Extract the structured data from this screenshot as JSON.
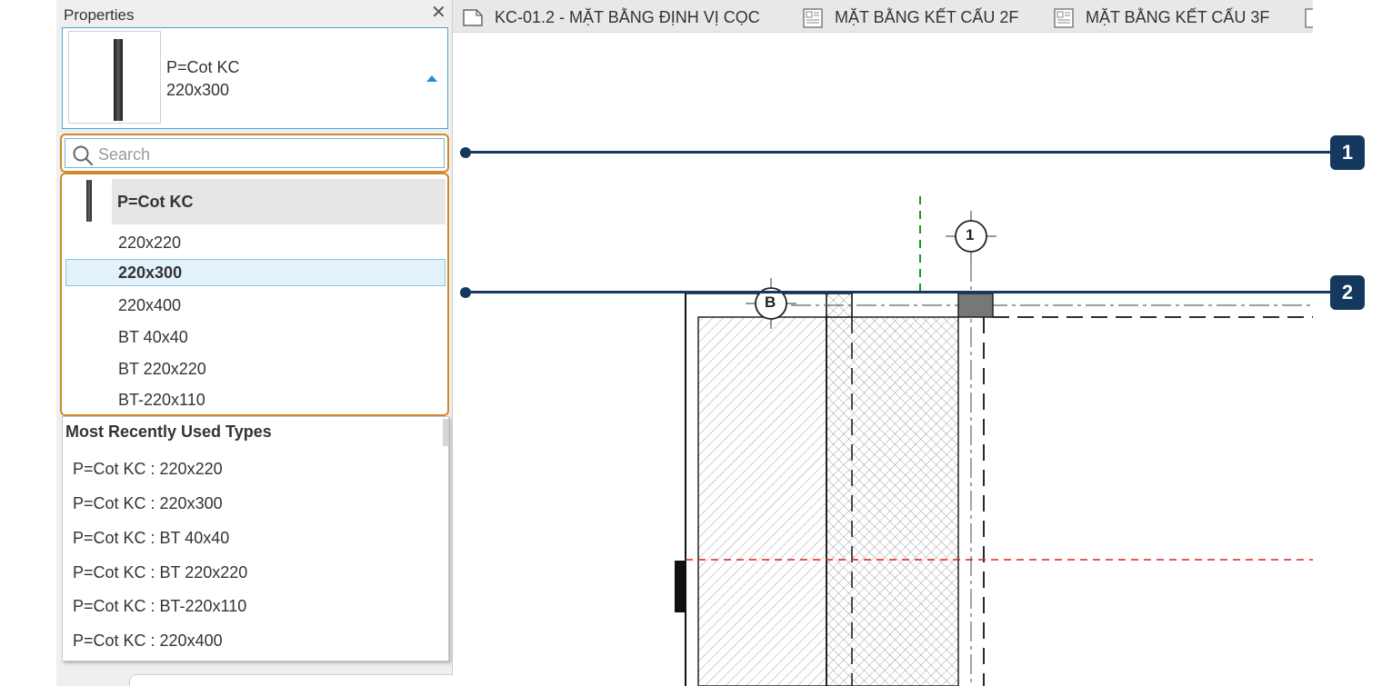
{
  "panel": {
    "title": "Properties",
    "close_glyph": "✕"
  },
  "type_selector": {
    "family": "P=Cot KC",
    "type": "220x300"
  },
  "search": {
    "placeholder": "Search"
  },
  "dropdown": {
    "family_label": "P=Cot KC",
    "types": [
      "220x220",
      "220x300",
      "220x400",
      "BT 40x40",
      "BT 220x220",
      "BT-220x110"
    ],
    "selected_index": 1
  },
  "mru": {
    "title": "Most Recently Used Types",
    "items": [
      "P=Cot KC : 220x220",
      "P=Cot KC : 220x300",
      "P=Cot KC : BT 40x40",
      "P=Cot KC : BT 220x220",
      "P=Cot KC : BT-220x110",
      "P=Cot KC : 220x400"
    ]
  },
  "tabs": [
    {
      "label": "KC-01.2 - MẶT BẰNG ĐỊNH VỊ CỌC",
      "icon": "plan-view-icon"
    },
    {
      "label": "MẶT BẰNG KẾT CẤU 2F",
      "icon": "sheet-icon"
    },
    {
      "label": "MẶT BẰNG KẾT CẤU 3F",
      "icon": "sheet-icon"
    }
  ],
  "drawing": {
    "grid_bubble_1": "1",
    "grid_bubble_b": "B"
  },
  "callouts": [
    "1",
    "2"
  ],
  "colors": {
    "accent_orange": "#d0892c",
    "callout_navy": "#15385e",
    "selection_blue": "#e3f1fa",
    "grid_red": "#e02020",
    "grid_green": "#1a9a1a"
  }
}
